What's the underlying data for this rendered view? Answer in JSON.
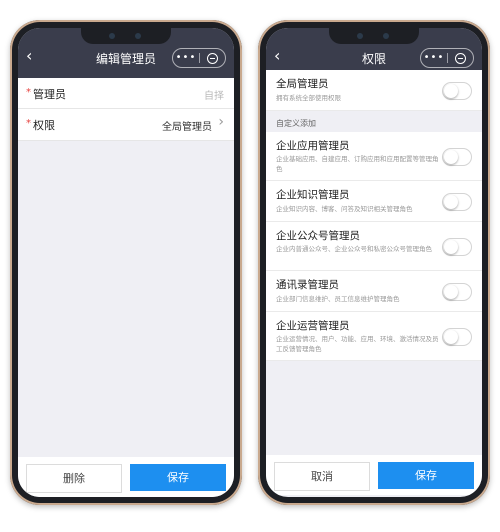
{
  "left_screen": {
    "title": "编辑管理员",
    "back_icon": "chevron-left-icon",
    "capsule": {
      "more": "•••",
      "close_icon": "minus-circle-icon"
    },
    "fields": [
      {
        "required_mark": "*",
        "label": "管理员",
        "value": "自择"
      },
      {
        "required_mark": "*",
        "label": "权限",
        "value": "全局管理员",
        "arrow": "›"
      }
    ],
    "buttons": {
      "delete": "删除",
      "save": "保存"
    }
  },
  "right_screen": {
    "title": "权限",
    "back_icon": "chevron-left-icon",
    "capsule": {
      "more": "•••",
      "close_icon": "minus-circle-icon"
    },
    "global": {
      "title": "全局管理员",
      "desc": "拥有系统全部使用权限"
    },
    "section_label": "自定义添加",
    "items": [
      {
        "title": "企业应用管理员",
        "desc": "企业基础应用、自建应用、订购应用和应用配置等管理角色"
      },
      {
        "title": "企业知识管理员",
        "desc": "企业知识内容、博客、问答及知识相关管理角色"
      },
      {
        "title": "企业公众号管理员",
        "desc": "企业内普通公众号、企业公众号和私密公众号管理角色"
      },
      {
        "title": "通讯录管理员",
        "desc": "企业部门信息维护、员工信息维护管理角色"
      },
      {
        "title": "企业运营管理员",
        "desc": "企业运营情况、用户、功能、应用、环境、激活情况及员工反馈管理角色"
      }
    ],
    "buttons": {
      "cancel": "取消",
      "save": "保存"
    }
  },
  "colors": {
    "nav_bg": "#3a3d4c",
    "primary_blue": "#1d8ff0",
    "required_red": "#e64340",
    "page_bg": "#efeff4"
  }
}
